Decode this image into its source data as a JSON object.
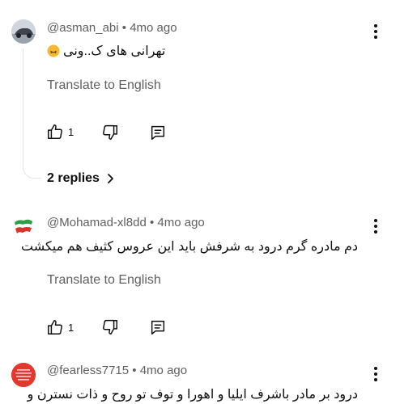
{
  "comments": [
    {
      "author": "@asman_abi",
      "time": "• 4mo ago",
      "text": "تهرانی های ک..ونی",
      "emoji": "🙃",
      "translate": "Translate to English",
      "likes": "1",
      "replies": "2 replies"
    },
    {
      "author": "@Mohamad-xl8dd",
      "time": "• 4mo ago",
      "text": "دم مادره گرم درود به شرفش باید این عروس کثیف هم میکشت",
      "translate": "Translate to English",
      "likes": "1"
    },
    {
      "author": "@fearless7715",
      "time": "• 4mo ago",
      "text": "درود بر مادر باشرف ایلیا و اهورا و توف تو روح و ذات نسترن و"
    }
  ],
  "icons": {
    "like": "thumb-up-icon",
    "dislike": "thumb-down-icon",
    "reply": "comment-icon",
    "more": "more-vertical-icon",
    "chevron": "chevron-right-icon"
  },
  "colors": {
    "text": "#0f0f0f",
    "secondary": "#606060",
    "thread": "#e5e5e5",
    "emoji": "#f7b733"
  }
}
